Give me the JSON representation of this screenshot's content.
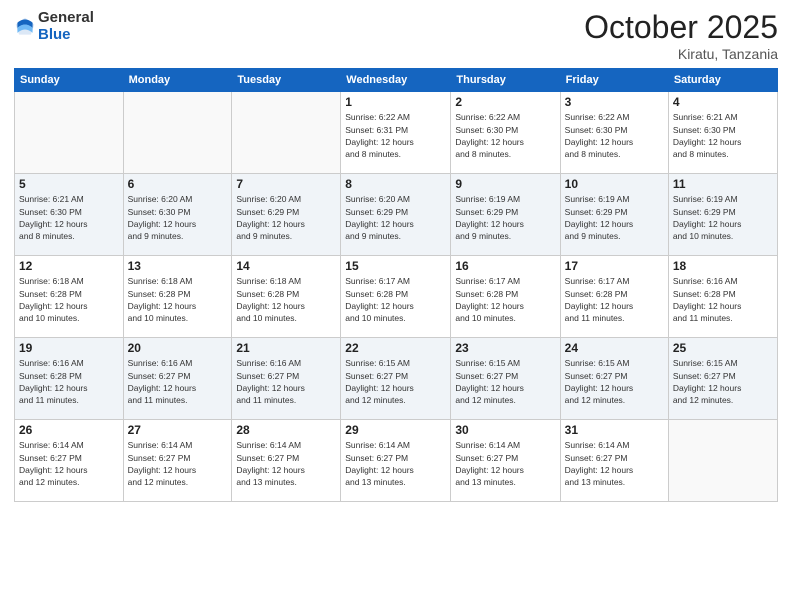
{
  "logo": {
    "general": "General",
    "blue": "Blue"
  },
  "header": {
    "month": "October 2025",
    "location": "Kiratu, Tanzania"
  },
  "weekdays": [
    "Sunday",
    "Monday",
    "Tuesday",
    "Wednesday",
    "Thursday",
    "Friday",
    "Saturday"
  ],
  "weeks": [
    [
      {
        "day": "",
        "info": ""
      },
      {
        "day": "",
        "info": ""
      },
      {
        "day": "",
        "info": ""
      },
      {
        "day": "1",
        "info": "Sunrise: 6:22 AM\nSunset: 6:31 PM\nDaylight: 12 hours\nand 8 minutes."
      },
      {
        "day": "2",
        "info": "Sunrise: 6:22 AM\nSunset: 6:30 PM\nDaylight: 12 hours\nand 8 minutes."
      },
      {
        "day": "3",
        "info": "Sunrise: 6:22 AM\nSunset: 6:30 PM\nDaylight: 12 hours\nand 8 minutes."
      },
      {
        "day": "4",
        "info": "Sunrise: 6:21 AM\nSunset: 6:30 PM\nDaylight: 12 hours\nand 8 minutes."
      }
    ],
    [
      {
        "day": "5",
        "info": "Sunrise: 6:21 AM\nSunset: 6:30 PM\nDaylight: 12 hours\nand 8 minutes."
      },
      {
        "day": "6",
        "info": "Sunrise: 6:20 AM\nSunset: 6:30 PM\nDaylight: 12 hours\nand 9 minutes."
      },
      {
        "day": "7",
        "info": "Sunrise: 6:20 AM\nSunset: 6:29 PM\nDaylight: 12 hours\nand 9 minutes."
      },
      {
        "day": "8",
        "info": "Sunrise: 6:20 AM\nSunset: 6:29 PM\nDaylight: 12 hours\nand 9 minutes."
      },
      {
        "day": "9",
        "info": "Sunrise: 6:19 AM\nSunset: 6:29 PM\nDaylight: 12 hours\nand 9 minutes."
      },
      {
        "day": "10",
        "info": "Sunrise: 6:19 AM\nSunset: 6:29 PM\nDaylight: 12 hours\nand 9 minutes."
      },
      {
        "day": "11",
        "info": "Sunrise: 6:19 AM\nSunset: 6:29 PM\nDaylight: 12 hours\nand 10 minutes."
      }
    ],
    [
      {
        "day": "12",
        "info": "Sunrise: 6:18 AM\nSunset: 6:28 PM\nDaylight: 12 hours\nand 10 minutes."
      },
      {
        "day": "13",
        "info": "Sunrise: 6:18 AM\nSunset: 6:28 PM\nDaylight: 12 hours\nand 10 minutes."
      },
      {
        "day": "14",
        "info": "Sunrise: 6:18 AM\nSunset: 6:28 PM\nDaylight: 12 hours\nand 10 minutes."
      },
      {
        "day": "15",
        "info": "Sunrise: 6:17 AM\nSunset: 6:28 PM\nDaylight: 12 hours\nand 10 minutes."
      },
      {
        "day": "16",
        "info": "Sunrise: 6:17 AM\nSunset: 6:28 PM\nDaylight: 12 hours\nand 10 minutes."
      },
      {
        "day": "17",
        "info": "Sunrise: 6:17 AM\nSunset: 6:28 PM\nDaylight: 12 hours\nand 11 minutes."
      },
      {
        "day": "18",
        "info": "Sunrise: 6:16 AM\nSunset: 6:28 PM\nDaylight: 12 hours\nand 11 minutes."
      }
    ],
    [
      {
        "day": "19",
        "info": "Sunrise: 6:16 AM\nSunset: 6:28 PM\nDaylight: 12 hours\nand 11 minutes."
      },
      {
        "day": "20",
        "info": "Sunrise: 6:16 AM\nSunset: 6:27 PM\nDaylight: 12 hours\nand 11 minutes."
      },
      {
        "day": "21",
        "info": "Sunrise: 6:16 AM\nSunset: 6:27 PM\nDaylight: 12 hours\nand 11 minutes."
      },
      {
        "day": "22",
        "info": "Sunrise: 6:15 AM\nSunset: 6:27 PM\nDaylight: 12 hours\nand 12 minutes."
      },
      {
        "day": "23",
        "info": "Sunrise: 6:15 AM\nSunset: 6:27 PM\nDaylight: 12 hours\nand 12 minutes."
      },
      {
        "day": "24",
        "info": "Sunrise: 6:15 AM\nSunset: 6:27 PM\nDaylight: 12 hours\nand 12 minutes."
      },
      {
        "day": "25",
        "info": "Sunrise: 6:15 AM\nSunset: 6:27 PM\nDaylight: 12 hours\nand 12 minutes."
      }
    ],
    [
      {
        "day": "26",
        "info": "Sunrise: 6:14 AM\nSunset: 6:27 PM\nDaylight: 12 hours\nand 12 minutes."
      },
      {
        "day": "27",
        "info": "Sunrise: 6:14 AM\nSunset: 6:27 PM\nDaylight: 12 hours\nand 12 minutes."
      },
      {
        "day": "28",
        "info": "Sunrise: 6:14 AM\nSunset: 6:27 PM\nDaylight: 12 hours\nand 13 minutes."
      },
      {
        "day": "29",
        "info": "Sunrise: 6:14 AM\nSunset: 6:27 PM\nDaylight: 12 hours\nand 13 minutes."
      },
      {
        "day": "30",
        "info": "Sunrise: 6:14 AM\nSunset: 6:27 PM\nDaylight: 12 hours\nand 13 minutes."
      },
      {
        "day": "31",
        "info": "Sunrise: 6:14 AM\nSunset: 6:27 PM\nDaylight: 12 hours\nand 13 minutes."
      },
      {
        "day": "",
        "info": ""
      }
    ]
  ]
}
